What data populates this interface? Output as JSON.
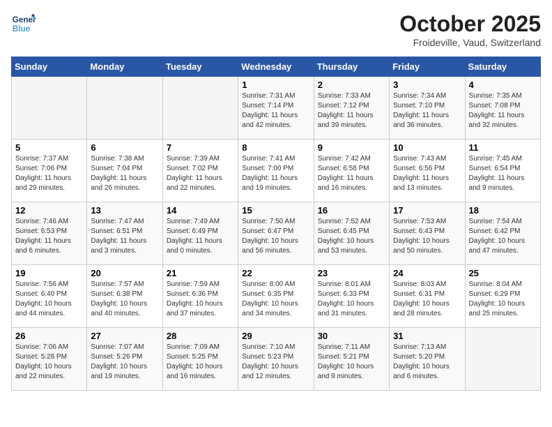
{
  "header": {
    "logo_line1": "General",
    "logo_line2": "Blue",
    "month": "October 2025",
    "location": "Froideville, Vaud, Switzerland"
  },
  "days_of_week": [
    "Sunday",
    "Monday",
    "Tuesday",
    "Wednesday",
    "Thursday",
    "Friday",
    "Saturday"
  ],
  "weeks": [
    [
      {
        "day": "",
        "info": ""
      },
      {
        "day": "",
        "info": ""
      },
      {
        "day": "",
        "info": ""
      },
      {
        "day": "1",
        "info": "Sunrise: 7:31 AM\nSunset: 7:14 PM\nDaylight: 11 hours\nand 42 minutes."
      },
      {
        "day": "2",
        "info": "Sunrise: 7:33 AM\nSunset: 7:12 PM\nDaylight: 11 hours\nand 39 minutes."
      },
      {
        "day": "3",
        "info": "Sunrise: 7:34 AM\nSunset: 7:10 PM\nDaylight: 11 hours\nand 36 minutes."
      },
      {
        "day": "4",
        "info": "Sunrise: 7:35 AM\nSunset: 7:08 PM\nDaylight: 11 hours\nand 32 minutes."
      }
    ],
    [
      {
        "day": "5",
        "info": "Sunrise: 7:37 AM\nSunset: 7:06 PM\nDaylight: 11 hours\nand 29 minutes."
      },
      {
        "day": "6",
        "info": "Sunrise: 7:38 AM\nSunset: 7:04 PM\nDaylight: 11 hours\nand 26 minutes."
      },
      {
        "day": "7",
        "info": "Sunrise: 7:39 AM\nSunset: 7:02 PM\nDaylight: 11 hours\nand 22 minutes."
      },
      {
        "day": "8",
        "info": "Sunrise: 7:41 AM\nSunset: 7:00 PM\nDaylight: 11 hours\nand 19 minutes."
      },
      {
        "day": "9",
        "info": "Sunrise: 7:42 AM\nSunset: 6:58 PM\nDaylight: 11 hours\nand 16 minutes."
      },
      {
        "day": "10",
        "info": "Sunrise: 7:43 AM\nSunset: 6:56 PM\nDaylight: 11 hours\nand 13 minutes."
      },
      {
        "day": "11",
        "info": "Sunrise: 7:45 AM\nSunset: 6:54 PM\nDaylight: 11 hours\nand 9 minutes."
      }
    ],
    [
      {
        "day": "12",
        "info": "Sunrise: 7:46 AM\nSunset: 6:53 PM\nDaylight: 11 hours\nand 6 minutes."
      },
      {
        "day": "13",
        "info": "Sunrise: 7:47 AM\nSunset: 6:51 PM\nDaylight: 11 hours\nand 3 minutes."
      },
      {
        "day": "14",
        "info": "Sunrise: 7:49 AM\nSunset: 6:49 PM\nDaylight: 11 hours\nand 0 minutes."
      },
      {
        "day": "15",
        "info": "Sunrise: 7:50 AM\nSunset: 6:47 PM\nDaylight: 10 hours\nand 56 minutes."
      },
      {
        "day": "16",
        "info": "Sunrise: 7:52 AM\nSunset: 6:45 PM\nDaylight: 10 hours\nand 53 minutes."
      },
      {
        "day": "17",
        "info": "Sunrise: 7:53 AM\nSunset: 6:43 PM\nDaylight: 10 hours\nand 50 minutes."
      },
      {
        "day": "18",
        "info": "Sunrise: 7:54 AM\nSunset: 6:42 PM\nDaylight: 10 hours\nand 47 minutes."
      }
    ],
    [
      {
        "day": "19",
        "info": "Sunrise: 7:56 AM\nSunset: 6:40 PM\nDaylight: 10 hours\nand 44 minutes."
      },
      {
        "day": "20",
        "info": "Sunrise: 7:57 AM\nSunset: 6:38 PM\nDaylight: 10 hours\nand 40 minutes."
      },
      {
        "day": "21",
        "info": "Sunrise: 7:59 AM\nSunset: 6:36 PM\nDaylight: 10 hours\nand 37 minutes."
      },
      {
        "day": "22",
        "info": "Sunrise: 8:00 AM\nSunset: 6:35 PM\nDaylight: 10 hours\nand 34 minutes."
      },
      {
        "day": "23",
        "info": "Sunrise: 8:01 AM\nSunset: 6:33 PM\nDaylight: 10 hours\nand 31 minutes."
      },
      {
        "day": "24",
        "info": "Sunrise: 8:03 AM\nSunset: 6:31 PM\nDaylight: 10 hours\nand 28 minutes."
      },
      {
        "day": "25",
        "info": "Sunrise: 8:04 AM\nSunset: 6:29 PM\nDaylight: 10 hours\nand 25 minutes."
      }
    ],
    [
      {
        "day": "26",
        "info": "Sunrise: 7:06 AM\nSunset: 5:28 PM\nDaylight: 10 hours\nand 22 minutes."
      },
      {
        "day": "27",
        "info": "Sunrise: 7:07 AM\nSunset: 5:26 PM\nDaylight: 10 hours\nand 19 minutes."
      },
      {
        "day": "28",
        "info": "Sunrise: 7:09 AM\nSunset: 5:25 PM\nDaylight: 10 hours\nand 16 minutes."
      },
      {
        "day": "29",
        "info": "Sunrise: 7:10 AM\nSunset: 5:23 PM\nDaylight: 10 hours\nand 12 minutes."
      },
      {
        "day": "30",
        "info": "Sunrise: 7:11 AM\nSunset: 5:21 PM\nDaylight: 10 hours\nand 9 minutes."
      },
      {
        "day": "31",
        "info": "Sunrise: 7:13 AM\nSunset: 5:20 PM\nDaylight: 10 hours\nand 6 minutes."
      },
      {
        "day": "",
        "info": ""
      }
    ]
  ]
}
